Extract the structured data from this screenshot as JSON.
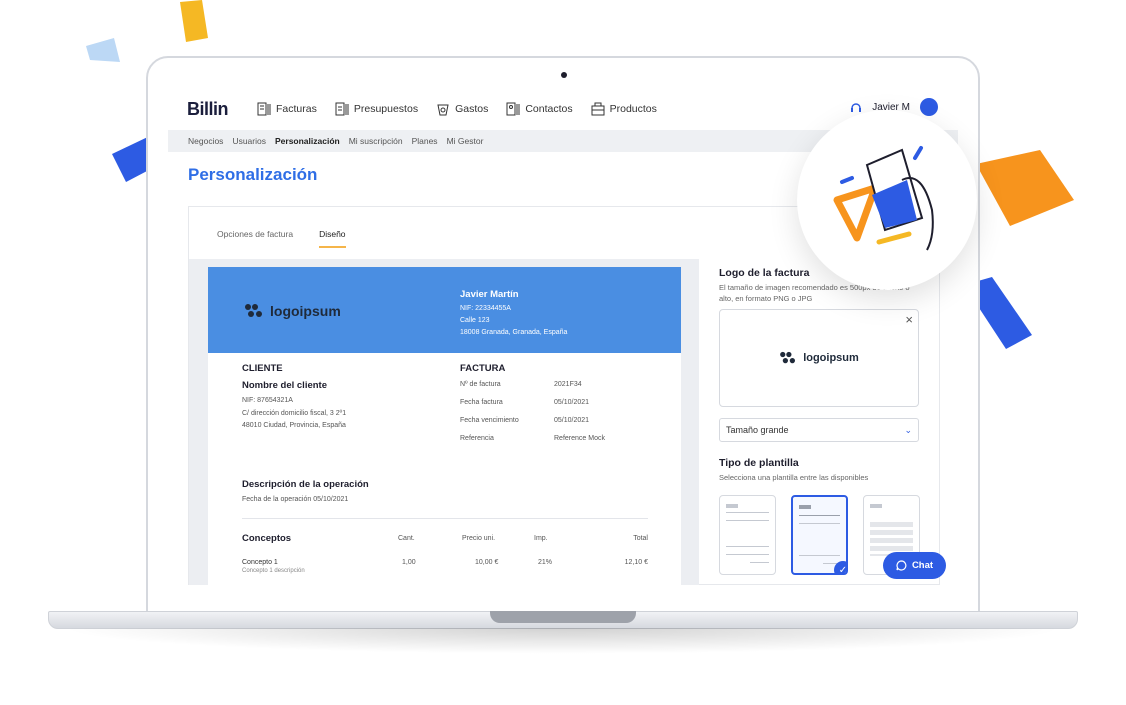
{
  "app": {
    "brand": "Billin"
  },
  "nav": {
    "items": [
      {
        "label": "Facturas",
        "icon": "invoice-icon"
      },
      {
        "label": "Presupuestos",
        "icon": "quote-icon"
      },
      {
        "label": "Gastos",
        "icon": "expense-icon"
      },
      {
        "label": "Contactos",
        "icon": "contacts-icon"
      },
      {
        "label": "Productos",
        "icon": "products-icon"
      }
    ],
    "user_name": "Javier M"
  },
  "subnav": [
    "Negocios",
    "Usuarios",
    "Personalización",
    "Mi suscripción",
    "Planes",
    "Mi Gestor"
  ],
  "page": {
    "title": "Personalización"
  },
  "tabs": [
    "Opciones de factura",
    "Diseño"
  ],
  "invoice": {
    "logo_text": "logoipsum",
    "issuer": {
      "name": "Javier Martín",
      "nif": "NIF: 22334455A",
      "street": "Calle 123",
      "city": "18008 Granada, Granada, España"
    },
    "client": {
      "heading": "CLIENTE",
      "name": "Nombre del cliente",
      "nif": "NIF: 87654321A",
      "address1": "C/ dirección domicilio fiscal, 3 2º1",
      "address2": "48010 Ciudad, Provincia, España"
    },
    "factura": {
      "heading": "FACTURA",
      "rows": [
        {
          "label": "Nº de factura",
          "value": "2021F34"
        },
        {
          "label": "Fecha factura",
          "value": "05/10/2021"
        },
        {
          "label": "Fecha vencimiento",
          "value": "05/10/2021"
        },
        {
          "label": "Referencia",
          "value": "Reference Mock"
        }
      ]
    },
    "operation": {
      "heading": "Descripción de la operación",
      "date_label": "Fecha de la operación",
      "date": "05/10/2021"
    },
    "concepts": {
      "headers": [
        "Conceptos",
        "Cant.",
        "Precio uni.",
        "Imp.",
        "Total"
      ],
      "rows": [
        {
          "name": "Concepto 1",
          "desc": "Concepto 1 descripción",
          "qty": "1,00",
          "price": "10,00 €",
          "tax": "21%",
          "total": "12,10 €"
        }
      ]
    }
  },
  "side": {
    "logo_title": "Logo de la factura",
    "logo_desc": "El tamaño de imagen recomendado es 500px de ancho o alto, en formato PNG o JPG",
    "size_select": "Tamaño grande",
    "template_title": "Tipo de plantilla",
    "template_desc": "Selecciona una plantilla entre las disponibles",
    "selected_template": 2
  },
  "chat": {
    "label": "Chat"
  },
  "colors": {
    "primary": "#2d5be3",
    "header_blue": "#4a8ee2",
    "accent_orange": "#f7941d",
    "accent_yellow": "#f5b54a"
  }
}
